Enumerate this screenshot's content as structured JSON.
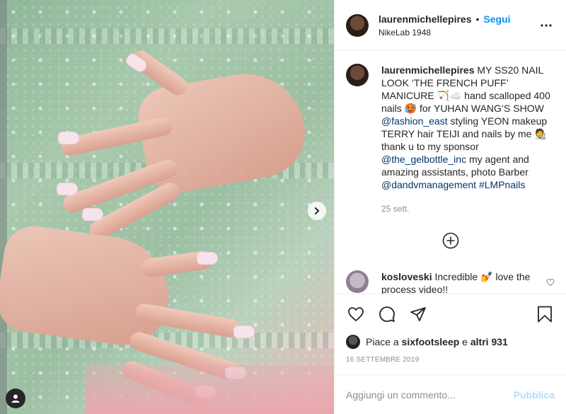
{
  "header": {
    "username": "laurenmichellepires",
    "separator": "•",
    "follow_label": "Segui",
    "location": "NikeLab 1948",
    "avatar_icon": "profile-avatar",
    "more_icon": "more-horizontal-icon"
  },
  "caption": {
    "username": "laurenmichellepires",
    "text_1": " MY SS20 NAIL LOOK ‘THE FRENCH PUFF’ MANICURE 🏹☁️ hand scalloped 400 nails 🥵 for YUHAN WANG’S SHOW ",
    "mention_1": "@fashion_east",
    "text_2": " styling YEON makeup TERRY hair TEIJI and nails by me 🧑‍🎨 thank u to my sponsor ",
    "mention_2": "@the_gelbottle_inc",
    "text_3": " my agent and amazing assistants, photo Barber ",
    "mention_3": "@dandvmanagement",
    "hashtag": " #LMPnails",
    "timestamp": "25 sett."
  },
  "load_more_icon": "plus-circle-icon",
  "comments": [
    {
      "username": "kosloveski",
      "text": " Incredible 💅 love the process video!!"
    }
  ],
  "actions": {
    "like_icon": "heart-icon",
    "comment_icon": "comment-icon",
    "share_icon": "send-icon",
    "save_icon": "bookmark-icon"
  },
  "likes": {
    "prefix": "Piace a ",
    "user": "sixfootsleep",
    "middle": " e ",
    "others": "altri 931"
  },
  "post_date": "16 SETTEMBRE 2019",
  "add_comment": {
    "placeholder": "Aggiungi un commento...",
    "publish_label": "Pubblica"
  },
  "colors": {
    "accent": "#0095f6",
    "publish_disabled": "#b2dffc",
    "secondary_text": "#8e8e8e",
    "mention": "#00376b"
  }
}
